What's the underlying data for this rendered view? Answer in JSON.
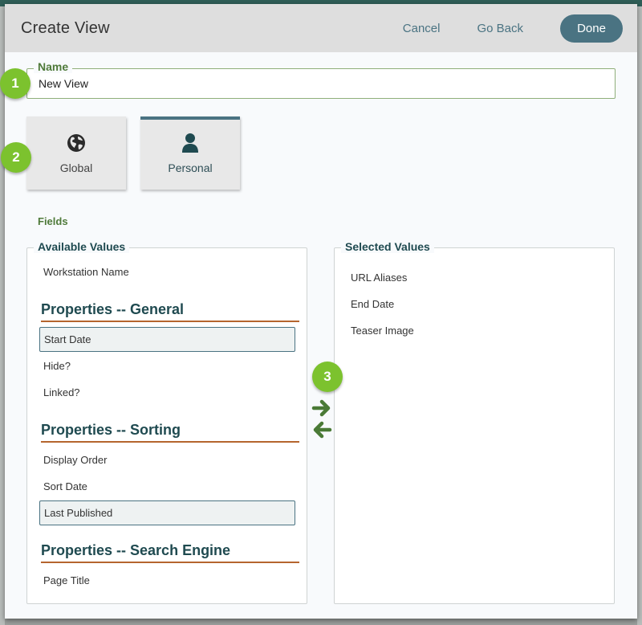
{
  "dialog": {
    "title": "Create View",
    "cancel_label": "Cancel",
    "go_back_label": "Go Back",
    "done_label": "Done"
  },
  "name_field": {
    "label": "Name",
    "value": "New View"
  },
  "scope": {
    "options": [
      {
        "label": "Global",
        "icon": "globe-icon",
        "selected": false
      },
      {
        "label": "Personal",
        "icon": "user-icon",
        "selected": true
      }
    ]
  },
  "fields": {
    "label": "Fields",
    "available": {
      "legend": "Available Values",
      "ungrouped": [
        "Workstation Name"
      ],
      "groups": [
        {
          "title": "Properties -- General",
          "items": [
            {
              "label": "Start Date",
              "highlighted": true
            },
            {
              "label": "Hide?",
              "highlighted": false
            },
            {
              "label": "Linked?",
              "highlighted": false
            }
          ]
        },
        {
          "title": "Properties -- Sorting",
          "items": [
            {
              "label": "Display Order",
              "highlighted": false
            },
            {
              "label": "Sort Date",
              "highlighted": false
            },
            {
              "label": "Last Published",
              "highlighted": true
            }
          ]
        },
        {
          "title": "Properties -- Search Engine",
          "items": [
            {
              "label": "Page Title",
              "highlighted": false
            }
          ]
        }
      ]
    },
    "selected": {
      "legend": "Selected Values",
      "items": [
        "URL Aliases",
        "End Date",
        "Teaser Image"
      ]
    },
    "transfer": {
      "add_icon": "arrow-right-icon",
      "remove_icon": "arrow-left-icon"
    }
  },
  "callouts": [
    "1",
    "2",
    "3"
  ],
  "colors": {
    "primary": "#4a7382",
    "accent_green": "#4f7a3a",
    "group_rule": "#b5652e",
    "callout": "#7cc22e",
    "arrow": "#4a7a36"
  }
}
